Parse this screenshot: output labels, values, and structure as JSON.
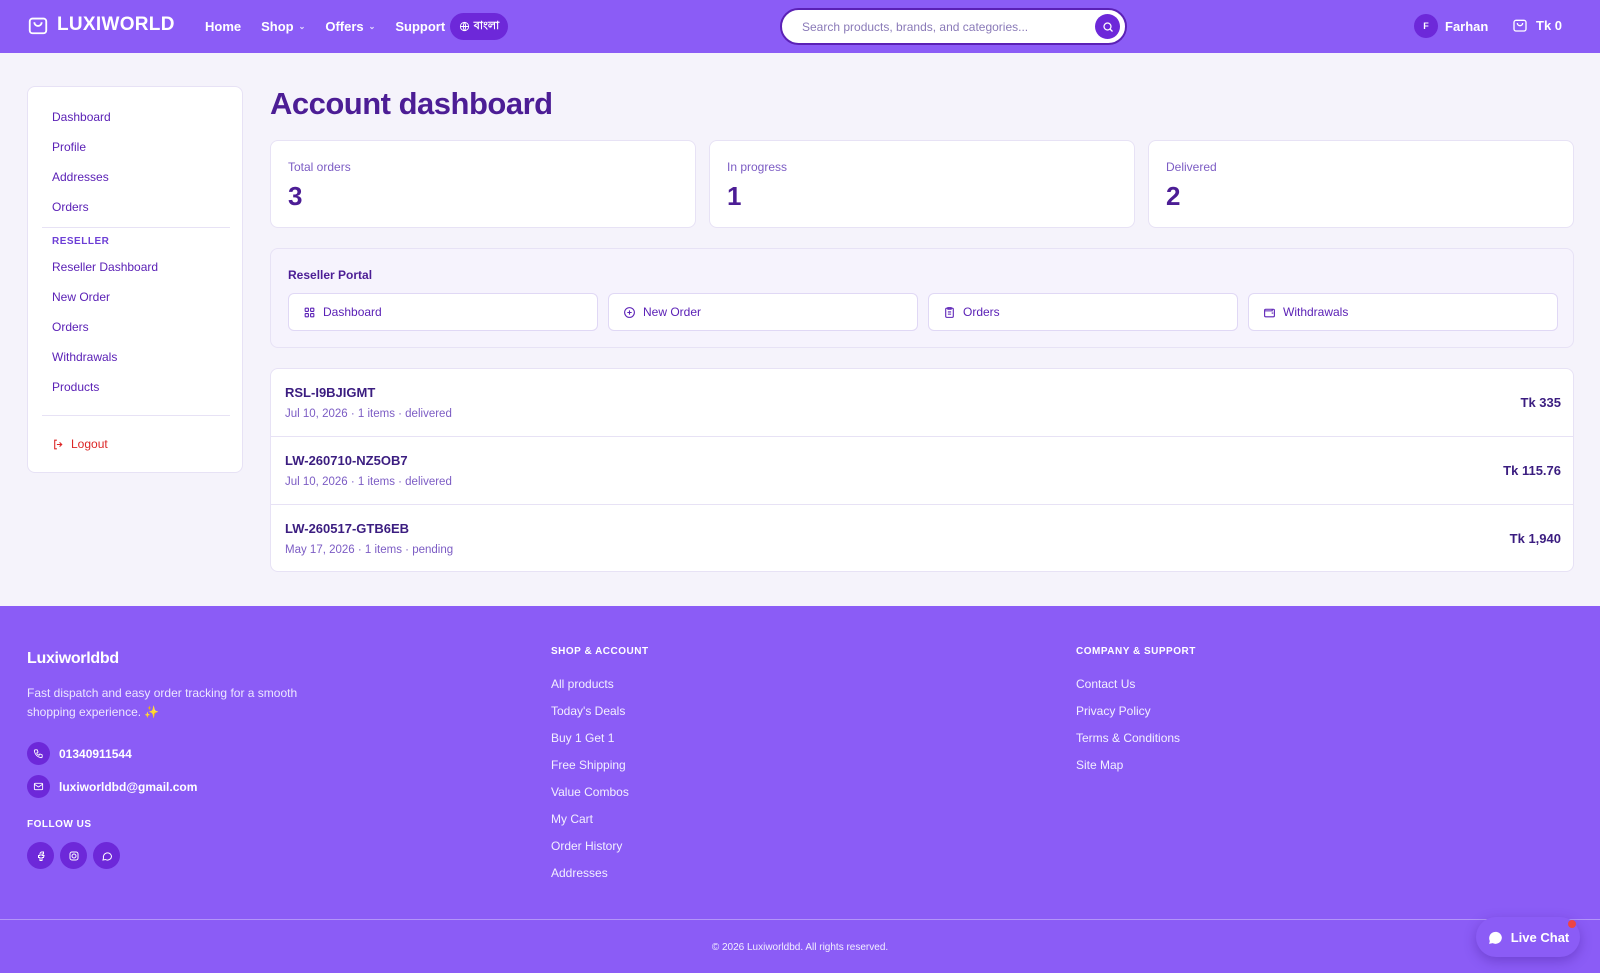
{
  "header": {
    "logo": "LUXIWORLD",
    "nav": [
      {
        "label": "Home"
      },
      {
        "label": "Shop",
        "dropdown": true
      },
      {
        "label": "Offers",
        "dropdown": true
      },
      {
        "label": "Support"
      }
    ],
    "language_label": "বাংলা",
    "search_placeholder": "Search products, brands, and categories...",
    "user_initial": "F",
    "user_name": "Farhan",
    "cart_label": "Tk 0"
  },
  "sidebar": {
    "account_links": [
      "Dashboard",
      "Profile",
      "Addresses",
      "Orders"
    ],
    "reseller_heading": "RESELLER",
    "reseller_links": [
      "Reseller Dashboard",
      "New Order",
      "Orders",
      "Withdrawals",
      "Products"
    ],
    "logout_label": "Logout"
  },
  "main": {
    "title": "Account dashboard",
    "stats": [
      {
        "label": "Total orders",
        "value": "3"
      },
      {
        "label": "In progress",
        "value": "1"
      },
      {
        "label": "Delivered",
        "value": "2"
      }
    ],
    "portal": {
      "title": "Reseller Portal",
      "buttons": [
        {
          "label": "Dashboard",
          "icon": "grid-icon"
        },
        {
          "label": "New Order",
          "icon": "plus-circle-icon"
        },
        {
          "label": "Orders",
          "icon": "clipboard-icon"
        },
        {
          "label": "Withdrawals",
          "icon": "wallet-icon"
        }
      ]
    },
    "orders": [
      {
        "id": "RSL-I9BJIGMT",
        "meta": "Jul 10, 2026 · 1 items · delivered",
        "total": "Tk 335"
      },
      {
        "id": "LW-260710-NZ5OB7",
        "meta": "Jul 10, 2026 · 1 items · delivered",
        "total": "Tk 115.76"
      },
      {
        "id": "LW-260517-GTB6EB",
        "meta": "May 17, 2026 · 1 items · pending",
        "total": "Tk 1,940"
      }
    ]
  },
  "footer": {
    "brand": "Luxiworldbd",
    "tagline": "Fast dispatch and easy order tracking for a smooth shopping experience. ✨",
    "phone": "01340911544",
    "email": "luxiworldbd@gmail.com",
    "follow_heading": "FOLLOW US",
    "shop_heading": "SHOP & ACCOUNT",
    "shop_links": [
      "All products",
      "Today's Deals",
      "Buy 1 Get 1",
      "Free Shipping",
      "Value Combos",
      "My Cart",
      "Order History",
      "Addresses"
    ],
    "company_heading": "COMPANY & SUPPORT",
    "company_links": [
      "Contact Us",
      "Privacy Policy",
      "Terms & Conditions",
      "Site Map"
    ],
    "copyright": "© 2026 Luxiworldbd. All rights reserved."
  },
  "live_chat_label": "Live Chat",
  "colors": {
    "primary": "#8b5cf6",
    "primary_dark": "#6d28d9",
    "text": "#4c1d95",
    "danger": "#dc2626"
  }
}
